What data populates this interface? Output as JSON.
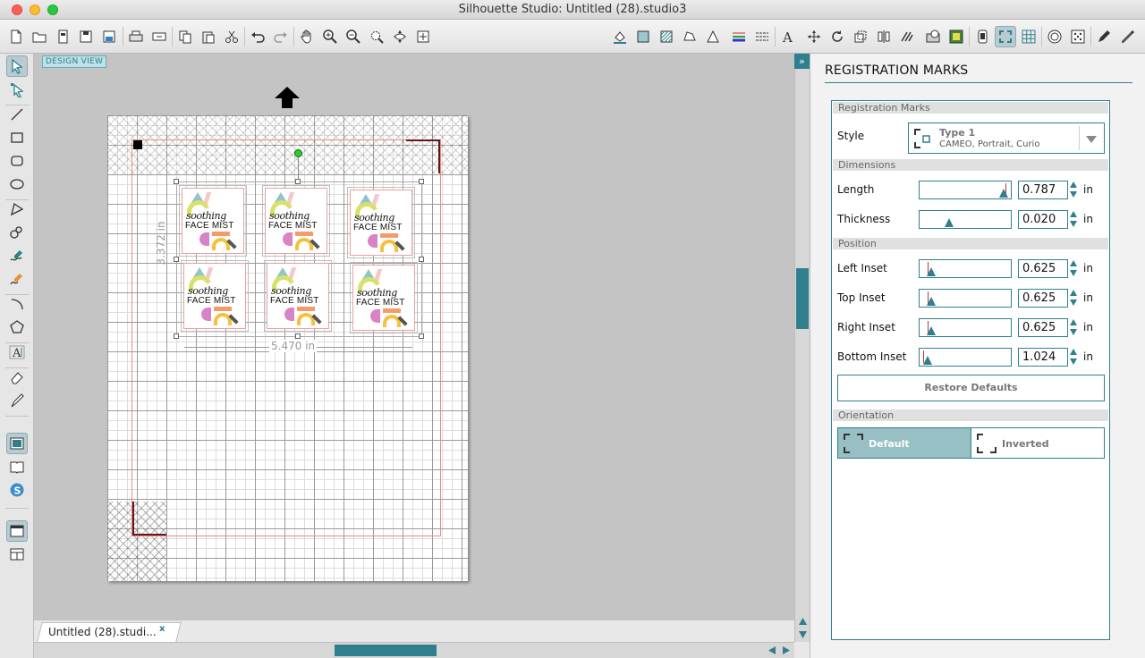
{
  "window": {
    "title": "Silhouette Studio: Untitled (28).studio3"
  },
  "icons": {
    "left_tools": [
      "select-icon",
      "point-edit-icon",
      "line-icon",
      "rectangle-icon",
      "rounded-rectangle-icon",
      "ellipse-icon",
      "polygon-icon",
      "freehand-icon",
      "sketch-icon",
      "smooth-freehand-icon",
      "arc-icon",
      "regular-polygon-icon",
      "text-icon",
      "eraser-icon",
      "knife-icon",
      "design-view-icon",
      "library-icon",
      "store-icon",
      "page-setup-icon",
      "split-view-icon"
    ]
  },
  "canvas": {
    "view_badge": "DESIGN VIEW",
    "dim_height": "3.372 in",
    "dim_width": "5.470 in",
    "sticker": {
      "script": "soothing",
      "face": "FACE MIST"
    }
  },
  "doc_tab": {
    "label": "Untitled (28).studi...",
    "close": "x"
  },
  "panel": {
    "title": "REGISTRATION MARKS",
    "sections": {
      "marks": "Registration Marks",
      "dimensions": "Dimensions",
      "position": "Position",
      "orientation": "Orientation"
    },
    "style": {
      "label": "Style",
      "selected_title": "Type 1",
      "selected_sub": "CAMEO, Portrait, Curio"
    },
    "fields": [
      {
        "label": "Length",
        "value": "0.787",
        "unit": "in",
        "slider_fraction": 0.97
      },
      {
        "label": "Thickness",
        "value": "0.020",
        "unit": "in",
        "slider_fraction": 0.3
      },
      {
        "label": "Left Inset",
        "value": "0.625",
        "unit": "in",
        "slider_fraction": 0.09
      },
      {
        "label": "Top Inset",
        "value": "0.625",
        "unit": "in",
        "slider_fraction": 0.09
      },
      {
        "label": "Right Inset",
        "value": "0.625",
        "unit": "in",
        "slider_fraction": 0.09
      },
      {
        "label": "Bottom Inset",
        "value": "1.024",
        "unit": "in",
        "slider_fraction": 0.04
      }
    ],
    "restore_label": "Restore Defaults",
    "orientation": {
      "default_label": "Default",
      "inverted_label": "Inverted",
      "selected": "Default"
    }
  },
  "colors": {
    "accent": "#2f7f8e",
    "selected_fill": "#98bfc4"
  }
}
